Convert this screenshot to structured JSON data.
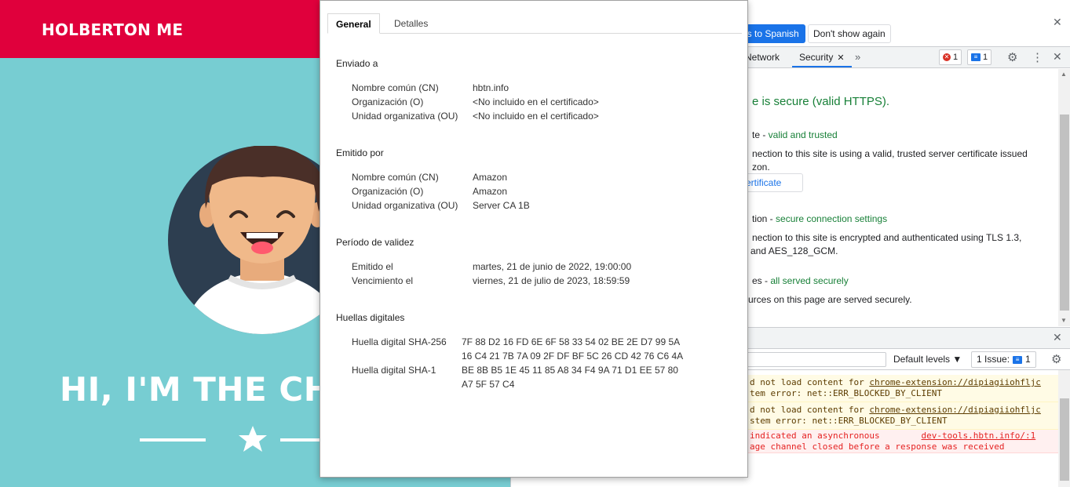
{
  "site": {
    "brand": "HOLBERTON ME",
    "hero_title": "HI, I'M THE CH"
  },
  "devtools": {
    "infobar": {
      "primary_button": "ls to Spanish",
      "secondary_button": "Don't show again"
    },
    "tabs": [
      {
        "label": "Network",
        "active": false
      },
      {
        "label": "Security",
        "active": true
      }
    ],
    "error_count": "1",
    "message_count": "1",
    "security": {
      "title": "e is secure (valid HTTPS).",
      "cert_heading_prefix": "te - ",
      "cert_heading_status": "valid and trusted",
      "cert_text_1": "nection to this site is using a valid, trusted server certificate issued",
      "cert_text_2": "zon.",
      "view_button": " certificate",
      "conn_heading_prefix": "tion - ",
      "conn_heading_status": "secure connection settings",
      "conn_text_1": "nection to this site is encrypted and authenticated using TLS 1.3,",
      "conn_text_2": "and AES_128_GCM.",
      "res_heading_prefix": "es - ",
      "res_heading_status": "all served securely",
      "res_text": "urces on this page are served securely."
    },
    "console": {
      "levels_label": "Default levels ▼",
      "issues_label": "1 Issue:",
      "issues_count": "1",
      "messages": [
        {
          "type": "warn",
          "line1_prefix": "d not load content for ",
          "line1_link": "chrome-extension://dipiagiiohfljc",
          "line2": "tem error: net::ERR_BLOCKED_BY_CLIENT"
        },
        {
          "type": "warn",
          "line1_prefix": "d not load content for ",
          "line1_link": "chrome-extension://dipiagiiohfljc",
          "line2": "stem error: net::ERR_BLOCKED_BY_CLIENT"
        },
        {
          "type": "error",
          "line1_prefix": "indicated an asynchronous        ",
          "line1_link": "dev-tools.hbtn.info/:1",
          "line2": "age channel closed before a response was received"
        }
      ]
    }
  },
  "certificate": {
    "tabs": {
      "general": "General",
      "details": "Detalles"
    },
    "issued_to": {
      "heading": "Enviado a",
      "rows": [
        {
          "label": "Nombre común (CN)",
          "value": "hbtn.info"
        },
        {
          "label": "Organización (O)",
          "value": "<No incluido en el certificado>"
        },
        {
          "label": "Unidad organizativa (OU)",
          "value": "<No incluido en el certificado>"
        }
      ]
    },
    "issued_by": {
      "heading": "Emitido por",
      "rows": [
        {
          "label": "Nombre común (CN)",
          "value": "Amazon"
        },
        {
          "label": "Organización (O)",
          "value": "Amazon"
        },
        {
          "label": "Unidad organizativa (OU)",
          "value": "Server CA 1B"
        }
      ]
    },
    "validity": {
      "heading": "Período de validez",
      "rows": [
        {
          "label": "Emitido el",
          "value": "martes, 21 de junio de 2022, 19:00:00"
        },
        {
          "label": "Vencimiento el",
          "value": "viernes, 21 de julio de 2023, 18:59:59"
        }
      ]
    },
    "fingerprints": {
      "heading": "Huellas digitales",
      "sha256_label": "Huella digital SHA-256",
      "sha256_line1": "7F 88 D2 16 FD 6E 6F 58 33 54 02 BE 2E D7 99 5A",
      "sha256_line2": "16 C4 21 7B 7A 09 2F DF BF 5C 26 CD 42 76 C6 4A",
      "sha1_label": "Huella digital SHA-1",
      "sha1_line1": "BE 8B B5 1E 45 11 85 A8 34 F4 9A 71 D1 EE 57 80",
      "sha1_line2": "A7 5F 57 C4"
    }
  }
}
